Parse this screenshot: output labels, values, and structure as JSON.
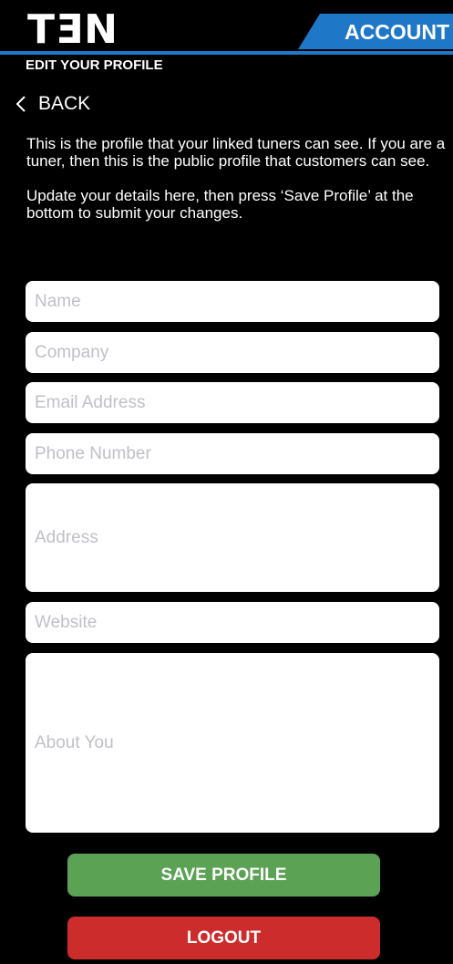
{
  "header": {
    "logo_text": "TƎN",
    "account_label": "ACCOUNT",
    "subtitle": "EDIT YOUR PROFILE"
  },
  "nav": {
    "back_label": "BACK"
  },
  "intro": {
    "paragraph1": "This is the profile that your linked tuners can see. If you are a tuner, then this is the public profile that customers can see.",
    "paragraph2": "Update your details here, then press ‘Save Profile’ at the bottom to submit your changes."
  },
  "form": {
    "name": {
      "placeholder": "Name",
      "value": ""
    },
    "company": {
      "placeholder": "Company",
      "value": ""
    },
    "email": {
      "placeholder": "Email Address",
      "value": ""
    },
    "phone": {
      "placeholder": "Phone Number",
      "value": ""
    },
    "address": {
      "placeholder": "Address",
      "value": ""
    },
    "website": {
      "placeholder": "Website",
      "value": ""
    },
    "about": {
      "placeholder": "About You",
      "value": ""
    }
  },
  "actions": {
    "save_label": "SAVE PROFILE",
    "logout_label": "LOGOUT"
  },
  "colors": {
    "accent": "#1f77c7",
    "save": "#5ba255",
    "logout": "#cc2c2c",
    "background": "#000000"
  },
  "icons": {
    "back": "chevron-left-icon"
  }
}
